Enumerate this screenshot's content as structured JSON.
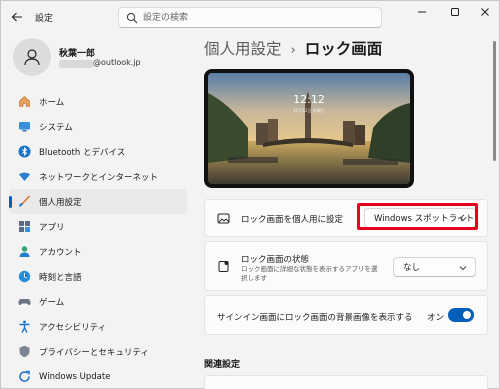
{
  "window": {
    "title": "設定",
    "search_placeholder": "設定の検索"
  },
  "user": {
    "name": "秋葉一郎",
    "email_suffix": "@outlook.jp"
  },
  "sidebar": {
    "items": [
      {
        "label": "ホーム",
        "icon": "home-icon"
      },
      {
        "label": "システム",
        "icon": "display-icon"
      },
      {
        "label": "Bluetooth とデバイス",
        "icon": "bluetooth-icon"
      },
      {
        "label": "ネットワークとインターネット",
        "icon": "wifi-icon"
      },
      {
        "label": "個人用設定",
        "icon": "brush-icon",
        "active": true
      },
      {
        "label": "アプリ",
        "icon": "apps-icon"
      },
      {
        "label": "アカウント",
        "icon": "account-icon"
      },
      {
        "label": "時刻と言語",
        "icon": "globe-clock-icon"
      },
      {
        "label": "ゲーム",
        "icon": "gamepad-icon"
      },
      {
        "label": "アクセシビリティ",
        "icon": "accessibility-icon"
      },
      {
        "label": "プライバシーとセキュリティ",
        "icon": "shield-icon"
      },
      {
        "label": "Windows Update",
        "icon": "update-icon"
      }
    ]
  },
  "breadcrumb": {
    "parent": "個人用設定",
    "separator": "›",
    "current": "ロック画面"
  },
  "preview": {
    "time": "12:12",
    "date": "12月12日 木曜日"
  },
  "settings": {
    "personalize": {
      "label": "ロック画面を個人用に設定",
      "value": "Windows スポットライト"
    },
    "status": {
      "label": "ロック画面の状態",
      "description": "ロック画面に詳細な状態を表示するアプリを選択します",
      "value": "なし"
    },
    "signin_background": {
      "label": "サインイン画面にロック画面の背景画像を表示する",
      "state_label": "オン",
      "enabled": true
    }
  },
  "related": {
    "title": "関連設定"
  },
  "colors": {
    "accent": "#005fb8",
    "highlight": "#e8001c"
  }
}
